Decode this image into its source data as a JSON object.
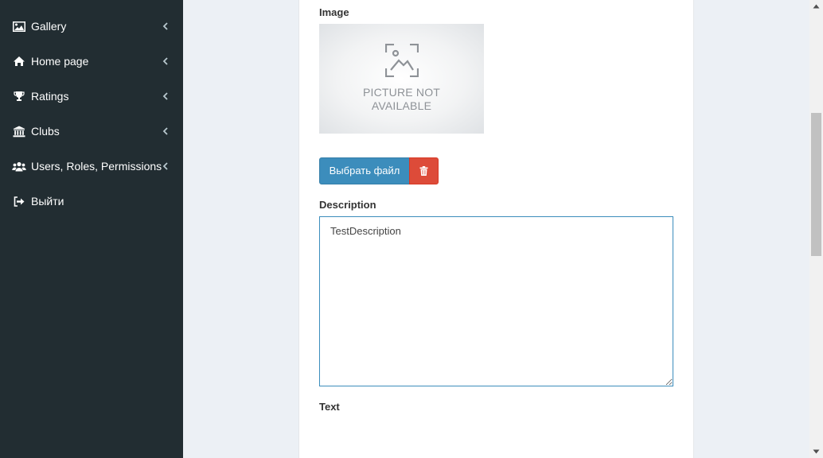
{
  "sidebar": {
    "items": [
      {
        "label": "Gallery",
        "icon": "image-icon",
        "has_submenu": true
      },
      {
        "label": "Home page",
        "icon": "home-icon",
        "has_submenu": true
      },
      {
        "label": "Ratings",
        "icon": "trophy-icon",
        "has_submenu": true
      },
      {
        "label": "Clubs",
        "icon": "bank-icon",
        "has_submenu": true
      },
      {
        "label": "Users, Roles, Permissions",
        "icon": "users-icon",
        "has_submenu": true
      },
      {
        "label": "Выйти",
        "icon": "sign-out-icon",
        "has_submenu": false
      }
    ]
  },
  "form": {
    "image_label": "Image",
    "image_placeholder_line1": "PICTURE NOT",
    "image_placeholder_line2": "AVAILABLE",
    "choose_file_label": "Выбрать файл",
    "description_label": "Description",
    "description_value": "TestDescription",
    "text_label": "Text"
  },
  "colors": {
    "sidebar_bg": "#222d32",
    "primary": "#3c8dbc",
    "danger": "#dd4b39",
    "page_bg": "#ecf0f5"
  }
}
